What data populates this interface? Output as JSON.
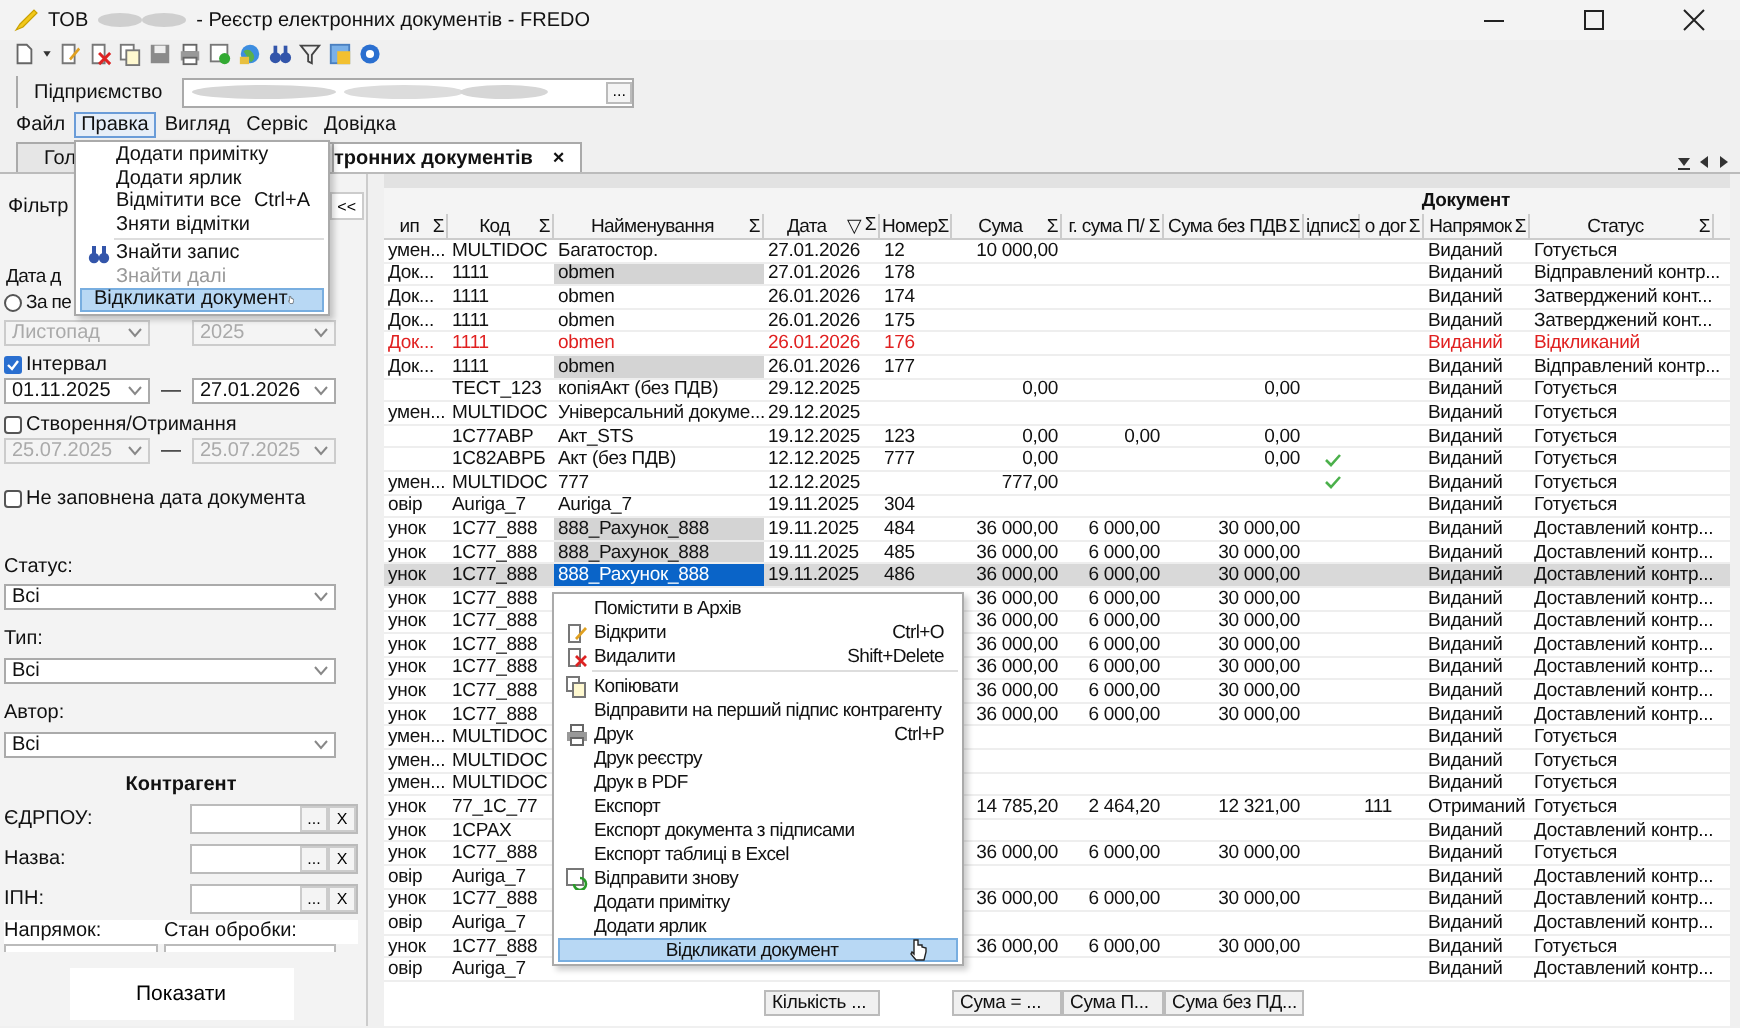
{
  "window": {
    "title_prefix": "ТОВ",
    "title": "- Реєстр електронних документів - FREDO"
  },
  "enterprise": {
    "label": "Підприємство",
    "browse": "..."
  },
  "menu": [
    {
      "label": "Файл",
      "selected": false
    },
    {
      "label": "Правка",
      "selected": true
    },
    {
      "label": "Вигляд",
      "selected": false
    },
    {
      "label": "Сервіс",
      "selected": false
    },
    {
      "label": "Довідка",
      "selected": false
    }
  ],
  "tabs": [
    {
      "label": "Гол",
      "selected": false
    },
    {
      "label": "тронних документів",
      "selected": true,
      "close": "×"
    }
  ],
  "edit_menu": [
    {
      "label": "Додати примітку",
      "disabled": false,
      "highlighted": false
    },
    {
      "label": "Додати ярлик",
      "disabled": false,
      "highlighted": false
    },
    {
      "label": "Відмітити все",
      "shortcut": "Ctrl+A",
      "disabled": false,
      "highlighted": false
    },
    {
      "label": "Зняти відмітки",
      "disabled": false,
      "highlighted": false
    },
    {
      "label": "Знайти запис",
      "icon": true,
      "separator_before": true,
      "disabled": false,
      "highlighted": false
    },
    {
      "label": "Знайти далі",
      "disabled": true,
      "highlighted": false
    },
    {
      "label": "Відкликати документ",
      "disabled": false,
      "highlighted": true
    }
  ],
  "filter": {
    "title": "Фільтр",
    "collapse": "<<",
    "date_label": "Дата д",
    "period": {
      "label": "За пе",
      "selected": false
    },
    "month": {
      "value": "Листопад",
      "disabled": true
    },
    "year": {
      "value": "2025",
      "disabled": true
    },
    "interval": {
      "label": "Інтервал",
      "checked": true,
      "from": "01.11.2025",
      "to": "27.01.2026",
      "dash": "—"
    },
    "created": {
      "label": "Створення/Отримання",
      "checked": false,
      "from": "25.07.2025",
      "to": "25.07.2025",
      "dash": "—",
      "disabled": true
    },
    "empty_date": {
      "label": "Не заповнена дата документа",
      "checked": false
    },
    "selects": [
      {
        "label": "Статус:",
        "value": "Всі"
      },
      {
        "label": "Тип:",
        "value": "Всі"
      },
      {
        "label": "Автор:",
        "value": "Всі"
      }
    ],
    "counterparty_title": "Контрагент",
    "counterparty": [
      {
        "label": "ЄДРПОУ:",
        "browse": "...",
        "clear": "X"
      },
      {
        "label": "Назва:",
        "browse": "...",
        "clear": "X"
      },
      {
        "label": "ІПН:",
        "browse": "...",
        "clear": "X"
      }
    ],
    "direction_label": "Напрямок:",
    "processing_label": "Стан обробки:",
    "show_button": "Показати"
  },
  "table": {
    "group_header": "Документ",
    "columns": [
      {
        "label": "ип",
        "sum": "Σ"
      },
      {
        "label": "Код",
        "sum": "Σ"
      },
      {
        "label": "Найменування",
        "sum": "Σ"
      },
      {
        "label": "Дата",
        "sort": "▽",
        "sum": "Σ"
      },
      {
        "label": "Номер",
        "sum": "Σ"
      },
      {
        "label": "Сума",
        "sum": "Σ"
      },
      {
        "label": "г. сума П/",
        "sum": "Σ"
      },
      {
        "label": "Сума без ПДВ",
        "sum": "Σ"
      },
      {
        "label": "ідпис",
        "sum": "Σ"
      },
      {
        "label": "о дог",
        "sum": "Σ"
      },
      {
        "label": "Напрямок",
        "sum": "Σ"
      },
      {
        "label": "Статус",
        "sum": "Σ"
      }
    ],
    "rows": [
      {
        "cells": [
          "умен...",
          "MULTIDOC",
          "Багатостор.",
          "27.01.2026",
          "12",
          "10 000,00",
          null,
          null,
          null,
          null,
          "Виданий",
          "Готується"
        ],
        "selected": false,
        "recalled": false,
        "marked": false,
        "signed": false
      },
      {
        "cells": [
          "Док...",
          "1111",
          "obmen",
          "27.01.2026",
          "178",
          null,
          null,
          null,
          null,
          null,
          "Виданий",
          "Відправлений контр..."
        ],
        "selected": false,
        "recalled": false,
        "marked": true,
        "signed": false
      },
      {
        "cells": [
          "Док...",
          "1111",
          "obmen",
          "26.01.2026",
          "174",
          null,
          null,
          null,
          null,
          null,
          "Виданий",
          "Затверджений конт..."
        ],
        "selected": false,
        "recalled": false,
        "marked": false,
        "signed": false
      },
      {
        "cells": [
          "Док...",
          "1111",
          "obmen",
          "26.01.2026",
          "175",
          null,
          null,
          null,
          null,
          null,
          "Виданий",
          "Затверджений конт..."
        ],
        "selected": false,
        "recalled": false,
        "marked": false,
        "signed": false
      },
      {
        "cells": [
          "Док...",
          "1111",
          "obmen",
          "26.01.2026",
          "176",
          null,
          null,
          null,
          null,
          null,
          "Виданий",
          "Відкликаний"
        ],
        "selected": false,
        "recalled": true,
        "marked": false,
        "signed": false
      },
      {
        "cells": [
          "Док...",
          "1111",
          "obmen",
          "26.01.2026",
          "177",
          null,
          null,
          null,
          null,
          null,
          "Виданий",
          "Відправлений контр..."
        ],
        "selected": false,
        "recalled": false,
        "marked": true,
        "signed": false
      },
      {
        "cells": [
          null,
          "TECT_123",
          "копіяАкт (без ПДВ)",
          "29.12.2025",
          null,
          "0,00",
          null,
          "0,00",
          null,
          null,
          "Виданий",
          "Готується"
        ],
        "selected": false,
        "recalled": false,
        "marked": false,
        "signed": false
      },
      {
        "cells": [
          "умен...",
          "MULTIDOC",
          "Універсальний докуме...",
          "29.12.2025",
          null,
          null,
          null,
          null,
          null,
          null,
          "Виданий",
          "Готується"
        ],
        "selected": false,
        "recalled": false,
        "marked": false,
        "signed": false
      },
      {
        "cells": [
          null,
          "1C77ABP",
          "Акт_STS",
          "19.12.2025",
          "123",
          "0,00",
          "0,00",
          "0,00",
          null,
          null,
          "Виданий",
          "Готується"
        ],
        "selected": false,
        "recalled": false,
        "marked": false,
        "signed": false
      },
      {
        "cells": [
          null,
          "1C82ABPБ",
          "Акт (без ПДВ)",
          "12.12.2025",
          "777",
          "0,00",
          null,
          "0,00",
          null,
          null,
          "Виданий",
          "Готується"
        ],
        "selected": false,
        "recalled": false,
        "marked": false,
        "signed": true
      },
      {
        "cells": [
          "умен...",
          "MULTIDOC",
          "777",
          "12.12.2025",
          null,
          "777,00",
          null,
          null,
          null,
          null,
          "Виданий",
          "Готується"
        ],
        "selected": false,
        "recalled": false,
        "marked": false,
        "signed": true
      },
      {
        "cells": [
          "овір",
          "Auriga_7",
          "Auriga_7",
          "19.11.2025",
          "304",
          null,
          null,
          null,
          null,
          null,
          "Виданий",
          "Готується"
        ],
        "selected": false,
        "recalled": false,
        "marked": false,
        "signed": false
      },
      {
        "cells": [
          "унок",
          "1C77_888",
          "888_Рахунок_888",
          "19.11.2025",
          "484",
          "36 000,00",
          "6 000,00",
          "30 000,00",
          null,
          null,
          "Виданий",
          "Доставлений контр..."
        ],
        "selected": false,
        "recalled": false,
        "marked": true,
        "signed": false
      },
      {
        "cells": [
          "унок",
          "1C77_888",
          "888_Рахунок_888",
          "19.11.2025",
          "485",
          "36 000,00",
          "6 000,00",
          "30 000,00",
          null,
          null,
          "Виданий",
          "Доставлений контр..."
        ],
        "selected": false,
        "recalled": false,
        "marked": true,
        "signed": false
      },
      {
        "cells": [
          "унок",
          "1C77_888",
          "888_Рахунок_888",
          "19.11.2025",
          "486",
          "36 000,00",
          "6 000,00",
          "30 000,00",
          null,
          null,
          "Виданий",
          "Доставлений контр..."
        ],
        "selected": true,
        "recalled": false,
        "signed": false
      },
      {
        "cells": [
          "унок",
          "1C77_888",
          null,
          null,
          null,
          "36 000,00",
          "6 000,00",
          "30 000,00",
          null,
          null,
          "Виданий",
          "Доставлений контр..."
        ],
        "selected": false,
        "recalled": false,
        "signed": false
      },
      {
        "cells": [
          "унок",
          "1C77_888",
          null,
          null,
          null,
          "36 000,00",
          "6 000,00",
          "30 000,00",
          null,
          null,
          "Виданий",
          "Доставлений контр..."
        ],
        "selected": false,
        "recalled": false,
        "signed": false
      },
      {
        "cells": [
          "унок",
          "1C77_888",
          null,
          null,
          null,
          "36 000,00",
          "6 000,00",
          "30 000,00",
          null,
          null,
          "Виданий",
          "Доставлений контр..."
        ],
        "selected": false,
        "recalled": false,
        "signed": false
      },
      {
        "cells": [
          "унок",
          "1C77_888",
          null,
          null,
          null,
          "36 000,00",
          "6 000,00",
          "30 000,00",
          null,
          null,
          "Виданий",
          "Доставлений контр..."
        ],
        "selected": false,
        "recalled": false,
        "signed": false
      },
      {
        "cells": [
          "унок",
          "1C77_888",
          null,
          null,
          null,
          "36 000,00",
          "6 000,00",
          "30 000,00",
          null,
          null,
          "Виданий",
          "Доставлений контр..."
        ],
        "selected": false,
        "recalled": false,
        "signed": false
      },
      {
        "cells": [
          "унок",
          "1C77_888",
          null,
          null,
          null,
          "36 000,00",
          "6 000,00",
          "30 000,00",
          null,
          null,
          "Виданий",
          "Доставлений контр..."
        ],
        "selected": false,
        "recalled": false,
        "signed": false
      },
      {
        "cells": [
          "умен...",
          "MULTIDOC",
          null,
          null,
          null,
          null,
          null,
          null,
          null,
          null,
          "Виданий",
          "Готується"
        ],
        "selected": false,
        "recalled": false,
        "signed": false
      },
      {
        "cells": [
          "умен...",
          "MULTIDOC",
          null,
          null,
          null,
          null,
          null,
          null,
          null,
          null,
          "Виданий",
          "Готується"
        ],
        "selected": false,
        "recalled": false,
        "signed": false
      },
      {
        "cells": [
          "умен...",
          "MULTIDOC",
          null,
          null,
          null,
          null,
          null,
          null,
          null,
          null,
          "Виданий",
          "Готується"
        ],
        "selected": false,
        "recalled": false,
        "signed": false
      },
      {
        "cells": [
          "унок",
          "77_1C_77",
          null,
          null,
          null,
          "14 785,20",
          "2 464,20",
          "12 321,00",
          null,
          "111",
          "Отриманий",
          "Готується"
        ],
        "selected": false,
        "recalled": false,
        "signed": false
      },
      {
        "cells": [
          "унок",
          "1CPAX",
          null,
          null,
          null,
          null,
          null,
          null,
          null,
          null,
          "Виданий",
          "Доставлений контр..."
        ],
        "selected": false,
        "recalled": false,
        "signed": false
      },
      {
        "cells": [
          "унок",
          "1C77_888",
          null,
          null,
          null,
          "36 000,00",
          "6 000,00",
          "30 000,00",
          null,
          null,
          "Виданий",
          "Готується"
        ],
        "selected": false,
        "recalled": false,
        "signed": false
      },
      {
        "cells": [
          "овір",
          "Auriga_7",
          null,
          null,
          null,
          null,
          null,
          null,
          null,
          null,
          "Виданий",
          "Доставлений контр..."
        ],
        "selected": false,
        "recalled": false,
        "signed": false
      },
      {
        "cells": [
          "унок",
          "1C77_888",
          null,
          null,
          null,
          "36 000,00",
          "6 000,00",
          "30 000,00",
          null,
          null,
          "Виданий",
          "Доставлений контр..."
        ],
        "selected": false,
        "recalled": false,
        "signed": false
      },
      {
        "cells": [
          "овір",
          "Auriga_7",
          null,
          null,
          null,
          null,
          null,
          null,
          null,
          null,
          "Виданий",
          "Доставлений контр..."
        ],
        "selected": false,
        "recalled": false,
        "signed": false
      },
      {
        "cells": [
          "унок",
          "1C77_888",
          null,
          null,
          null,
          "36 000,00",
          "6 000,00",
          "30 000,00",
          null,
          null,
          "Виданий",
          "Готується"
        ],
        "selected": false,
        "recalled": false,
        "signed": false
      },
      {
        "cells": [
          "овір",
          "Auriga_7",
          null,
          null,
          null,
          null,
          null,
          null,
          null,
          null,
          "Виданий",
          "Доставлений контр..."
        ],
        "selected": false,
        "recalled": false,
        "signed": false
      }
    ],
    "footer": [
      "Кількість ...",
      "Сума = ...",
      "Сума П...",
      "Сума без ПД..."
    ]
  },
  "context_menu": [
    {
      "label": "Помістити в Архів",
      "highlighted": false
    },
    {
      "label": "Відкрити",
      "shortcut": "Ctrl+O",
      "icon": true,
      "highlighted": false
    },
    {
      "label": "Видалити",
      "shortcut": "Shift+Delete",
      "icon": true,
      "highlighted": false
    },
    {
      "label": "Копіювати",
      "icon": true,
      "separator_before": true,
      "highlighted": false
    },
    {
      "label": "Відправити на перший підпис контрагенту",
      "highlighted": false
    },
    {
      "label": "Друк",
      "shortcut": "Ctrl+P",
      "icon": true,
      "highlighted": false
    },
    {
      "label": "Друк реєстру",
      "highlighted": false
    },
    {
      "label": "Друк в PDF",
      "highlighted": false
    },
    {
      "label": "Експорт",
      "highlighted": false
    },
    {
      "label": "Експорт документа з підписами",
      "highlighted": false
    },
    {
      "label": "Експорт таблиці в Excel",
      "highlighted": false
    },
    {
      "label": "Відправити знову",
      "icon": true,
      "highlighted": false
    },
    {
      "label": "Додати примітку",
      "highlighted": false
    },
    {
      "label": "Додати ярлик",
      "highlighted": false
    },
    {
      "label": "Відкликати документ",
      "highlighted": true
    }
  ]
}
